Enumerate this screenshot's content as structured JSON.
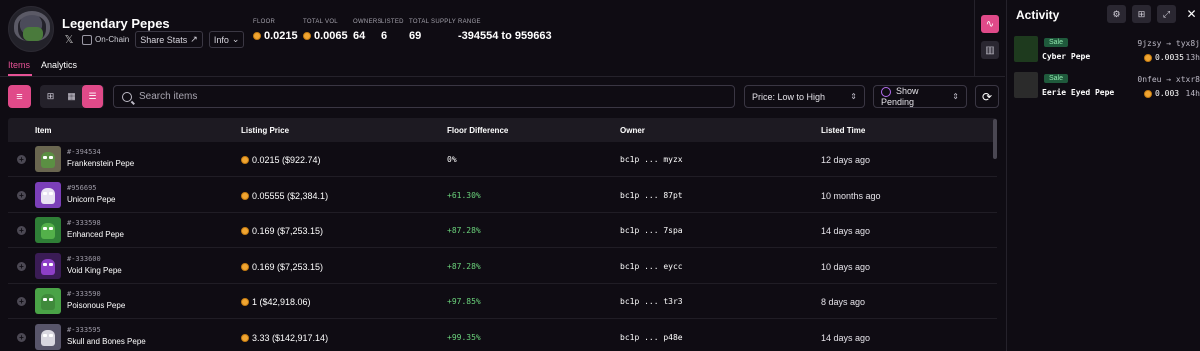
{
  "collection": {
    "name": "Legendary Pepes",
    "x_icon": "x-logo-icon",
    "chain_label": "On-Chain",
    "share_label": "Share Stats",
    "info_label": "Info"
  },
  "stats": [
    {
      "label": "FLOOR",
      "value": "0.0215",
      "coin": true
    },
    {
      "label": "TOTAL VOL",
      "value": "0.0065",
      "coin": true
    },
    {
      "label": "OWNERS",
      "value": "64",
      "coin": false
    },
    {
      "label": "LISTED",
      "value": "6",
      "coin": false
    },
    {
      "label": "TOTAL SUPPLY",
      "value": "69",
      "coin": false
    },
    {
      "label": "RANGE",
      "value": "-394554 to 959663",
      "coin": false
    }
  ],
  "tabs": [
    {
      "label": "Items",
      "active": true
    },
    {
      "label": "Analytics",
      "active": false
    }
  ],
  "toolbar": {
    "search_placeholder": "Search items",
    "sort_label": "Price: Low to High",
    "pending_label": "Show Pending"
  },
  "table": {
    "headers": [
      "Item",
      "Listing Price",
      "Floor Difference",
      "Owner",
      "Listed Time"
    ],
    "rows": [
      {
        "id": "#-394534",
        "name": "Frankenstein Pepe",
        "price": "0.0215 ($922.74)",
        "diff": "0%",
        "diff_positive": false,
        "owner": "bc1p ... myzx",
        "time": "12 days ago",
        "thumb_bg": "#6a6650",
        "skin": "#5b8f43"
      },
      {
        "id": "#956695",
        "name": "Unicorn Pepe",
        "price": "0.05555 ($2,384.1)",
        "diff": "+61.30%",
        "diff_positive": true,
        "owner": "bc1p ... 87pt",
        "time": "10 months ago",
        "thumb_bg": "#7b3fb8",
        "skin": "#e8e2f2"
      },
      {
        "id": "#-333598",
        "name": "Enhanced Pepe",
        "price": "0.169 ($7,253.15)",
        "diff": "+87.28%",
        "diff_positive": true,
        "owner": "bc1p ... 7spa",
        "time": "14 days ago",
        "thumb_bg": "#2f7f37",
        "skin": "#53b04a"
      },
      {
        "id": "#-333600",
        "name": "Void King Pepe",
        "price": "0.169 ($7,253.15)",
        "diff": "+87.28%",
        "diff_positive": true,
        "owner": "bc1p ... eycc",
        "time": "10 days ago",
        "thumb_bg": "#3a1c55",
        "skin": "#8d3fc7"
      },
      {
        "id": "#-333590",
        "name": "Poisonous Pepe",
        "price": "1 ($42,918.06)",
        "diff": "+97.85%",
        "diff_positive": true,
        "owner": "bc1p ... t3r3",
        "time": "8 days ago",
        "thumb_bg": "#4aa347",
        "skin": "#3f8a3b"
      },
      {
        "id": "#-333595",
        "name": "Skull and Bones Pepe",
        "price": "3.33 ($142,917.14)",
        "diff": "+99.35%",
        "diff_positive": true,
        "owner": "bc1p ... p48e",
        "time": "14 days ago",
        "thumb_bg": "#58556a",
        "skin": "#d9d7e0"
      }
    ]
  },
  "activity": {
    "title": "Activity",
    "items": [
      {
        "badge": "Sale",
        "name": "Cyber Pepe",
        "from_to": "9jzsy → tyx8j",
        "price": "0.0035",
        "time": "13h",
        "thumb_bg": "#1e3a1e"
      },
      {
        "badge": "Sale",
        "name": "Eerie Eyed Pepe",
        "from_to": "0nfeu → xtxr8",
        "price": "0.003",
        "time": "14h",
        "thumb_bg": "#2b2b2b"
      }
    ]
  },
  "colors": {
    "accent": "#e04a89",
    "positive": "#6bd37c",
    "coin": "#f0a531"
  }
}
